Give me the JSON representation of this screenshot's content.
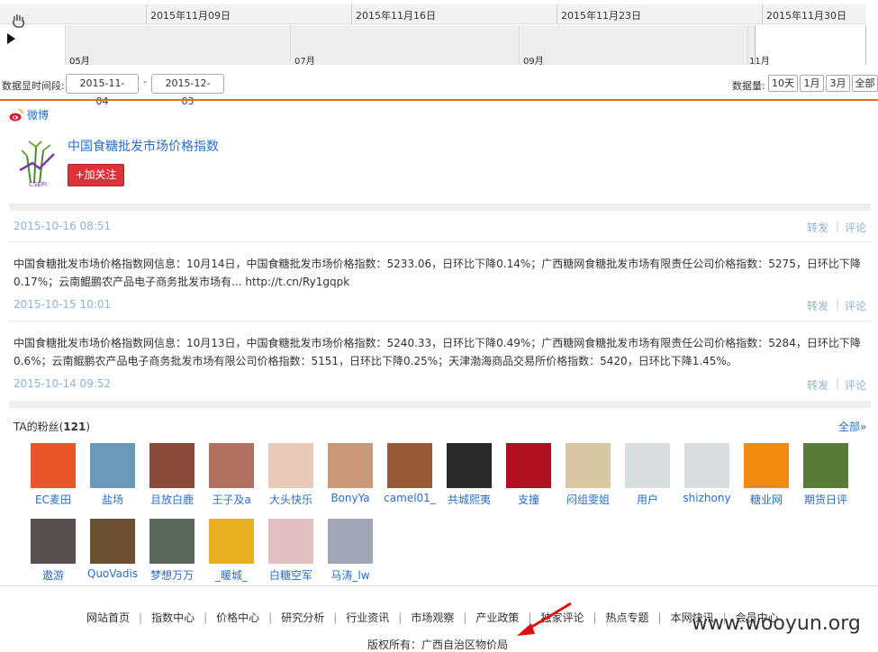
{
  "timeline": {
    "dates": [
      "2015年11月09日",
      "2015年11月16日",
      "2015年11月23日",
      "2015年11月30日"
    ],
    "months": [
      "05月",
      "07月",
      "09月",
      "11月"
    ]
  },
  "range": {
    "label": "数据显时间段:",
    "start": "2015-11-04",
    "dash": "-",
    "end": "2015-12-03",
    "zoom_label": "数据量:",
    "buttons": [
      "10天",
      "1月",
      "3月",
      "全部"
    ]
  },
  "weibo": {
    "section_label": "微博",
    "profile_name": "中国食糖批发市场价格指数",
    "follow_label": "+加关注",
    "repost_label": "转发",
    "comment_label": "评论",
    "posts": [
      {
        "date": "2015-10-16 08:51",
        "text": ""
      },
      {
        "date": "2015-10-15 10:01",
        "text": "中国食糖批发市场价格指数网信息：10月14日，中国食糖批发市场价格指数：5233.06，日环比下降0.14%；广西糖网食糖批发市场有限责任公司价格指数：5275，日环比下降0.17%；云南鲲鹏农产品电子商务批发市场有...",
        "link": "http://t.cn/Ry1gqpk"
      },
      {
        "date": "2015-10-14 09:52",
        "text": "中国食糖批发市场价格指数网信息：10月13日，中国食糖批发市场价格指数：5240.33，日环比下降0.49%；广西糖网食糖批发市场有限责任公司价格指数：5284，日环比下降0.6%；云南鲲鹏农产品电子商务批发市场有限公司价格指数：5151，日环比下降0.25%；天津渤海商品交易所价格指数：5420，日环比下降1.45%。",
        "link": ""
      }
    ]
  },
  "fans": {
    "title_prefix": "TA的粉丝",
    "count": "121",
    "all_label": "全部»",
    "items": [
      {
        "name": "EC麦田",
        "color": "#e8572a"
      },
      {
        "name": "盐场",
        "color": "#6a9ab8"
      },
      {
        "name": "且放白鹿",
        "color": "#8a4a3a"
      },
      {
        "name": "王子及a",
        "color": "#b07060"
      },
      {
        "name": "大头快乐",
        "color": "#e8c8b8"
      },
      {
        "name": "BonyYa",
        "color": "#c89878"
      },
      {
        "name": "camel01_",
        "color": "#9a5a3a"
      },
      {
        "name": "共城熙夷",
        "color": "#2a2a2a"
      },
      {
        "name": "支撞",
        "color": "#b01020"
      },
      {
        "name": "闷组雯姐",
        "color": "#d8c8a0"
      },
      {
        "name": "用户",
        "color": "#d8dde0"
      },
      {
        "name": "shizhony",
        "color": "#d8dde0"
      },
      {
        "name": "糖业网",
        "color": "#f08a10"
      },
      {
        "name": "期货日评",
        "color": "#5a7a3a"
      },
      {
        "name": "遨游",
        "color": "#5a5050"
      },
      {
        "name": "QuoVadis",
        "color": "#6a5030"
      },
      {
        "name": "梦想万万",
        "color": "#5a6a5a"
      },
      {
        "name": "_暖城_",
        "color": "#e8b020"
      },
      {
        "name": "白糖空军",
        "color": "#e0c0c0"
      },
      {
        "name": "马涛_lw",
        "color": "#a0a8b8"
      }
    ]
  },
  "footer": {
    "nav": [
      "网站首页",
      "指数中心",
      "价格中心",
      "研究分析",
      "行业资讯",
      "市场观察",
      "产业政策",
      "独家评论",
      "热点专题",
      "本网快讯",
      "会员中心"
    ],
    "copyright": "版权所有：广西自治区物价局",
    "watermark": "www.wooyun.org"
  }
}
